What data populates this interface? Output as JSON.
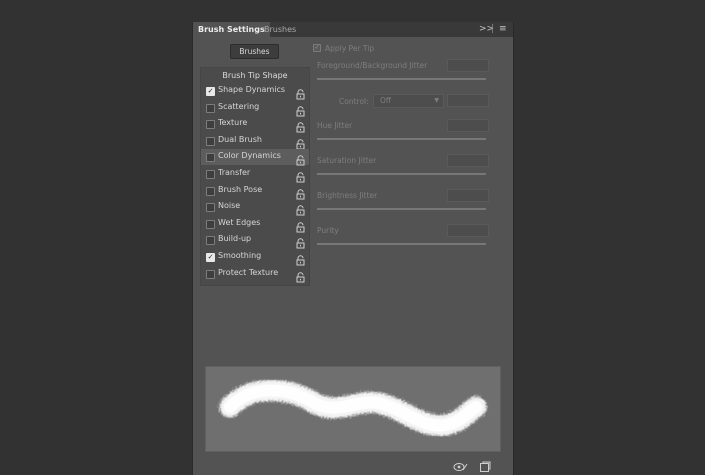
{
  "tabs": {
    "active": "Brush Settings",
    "inactive": "Brushes"
  },
  "panel_controls": {
    "expand": ">>",
    "menu": "≡"
  },
  "brushes_button": "Brushes",
  "list": {
    "header": "Brush Tip Shape",
    "items": [
      {
        "label": "Shape Dynamics",
        "checked": true
      },
      {
        "label": "Scattering",
        "checked": false
      },
      {
        "label": "Texture",
        "checked": false
      },
      {
        "label": "Dual Brush",
        "checked": false
      },
      {
        "label": "Color Dynamics",
        "checked": false
      },
      {
        "label": "Transfer",
        "checked": false
      },
      {
        "label": "Brush Pose",
        "checked": false
      },
      {
        "label": "Noise",
        "checked": false
      },
      {
        "label": "Wet Edges",
        "checked": false
      },
      {
        "label": "Build-up",
        "checked": false
      },
      {
        "label": "Smoothing",
        "checked": true
      },
      {
        "label": "Protect Texture",
        "checked": false
      }
    ]
  },
  "right": {
    "apply_per_tip": "Apply Per Tip",
    "fg_bg_jitter": "Foreground/Background Jitter",
    "control_label": "Control:",
    "control_value": "Off",
    "hue_jitter": "Hue Jitter",
    "saturation_jitter": "Saturation Jitter",
    "brightness_jitter": "Brightness Jitter",
    "purity": "Purity"
  },
  "colors": {
    "panel": "#535353",
    "background": "#323232",
    "preview_bg": "#6f6f6f"
  },
  "icons": [
    "lock-icon",
    "checkmark-icon",
    "create-new-brush-icon",
    "visibility-toggle-icon"
  ]
}
